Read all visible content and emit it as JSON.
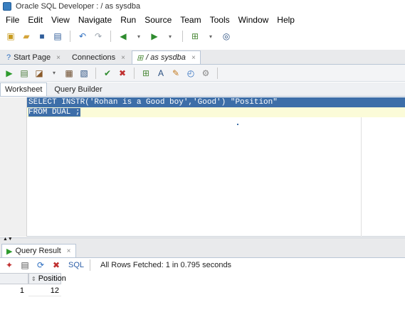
{
  "window": {
    "title": "Oracle SQL Developer : / as sysdba"
  },
  "menu": [
    "File",
    "Edit",
    "View",
    "Navigate",
    "Run",
    "Source",
    "Team",
    "Tools",
    "Window",
    "Help"
  ],
  "doc_tabs": [
    {
      "label": "Start Page",
      "active": false
    },
    {
      "label": "Connections",
      "active": false
    },
    {
      "label": "/ as sysdba",
      "active": true
    }
  ],
  "sub_tabs": [
    {
      "label": "Worksheet",
      "active": true
    },
    {
      "label": "Query Builder",
      "active": false
    }
  ],
  "editor": {
    "lines": [
      "SELECT INSTR('Rohan is a Good boy','Good') \"Position\"",
      "FROM DUAL ;"
    ]
  },
  "results": {
    "tab_label": "Query Result",
    "sql_label": "SQL",
    "status": "All Rows Fetched: 1 in 0.795 seconds",
    "columns": [
      "Position"
    ],
    "rows": [
      {
        "num": "1",
        "values": [
          "12"
        ]
      }
    ]
  },
  "colors": {
    "selection": "#3d6ea8",
    "current_line": "#fbfbd8"
  }
}
